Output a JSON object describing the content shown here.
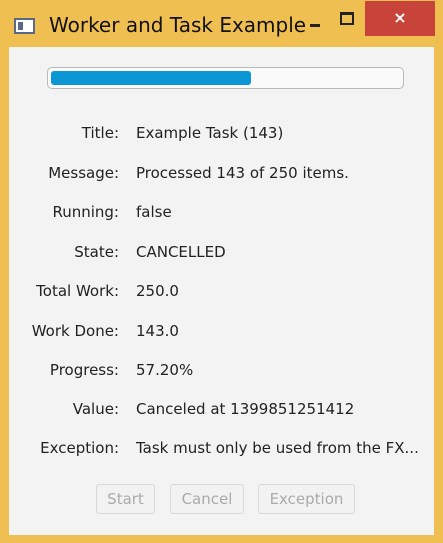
{
  "window": {
    "title": "Worker and Task Example",
    "icons": {
      "app": "window-icon",
      "minimize": "minimize-icon",
      "maximize": "maximize-icon",
      "close": "close-icon"
    },
    "close_glyph": "×",
    "accent_color": "#f0bf52",
    "close_color": "#c8433a"
  },
  "progress": {
    "fraction": 0.572,
    "fill_color": "#0b96d6"
  },
  "fields": [
    {
      "label": "Title:",
      "value": "Example Task (143)"
    },
    {
      "label": "Message:",
      "value": "Processed 143 of 250 items."
    },
    {
      "label": "Running:",
      "value": "false"
    },
    {
      "label": "State:",
      "value": "CANCELLED"
    },
    {
      "label": "Total Work:",
      "value": "250.0"
    },
    {
      "label": "Work Done:",
      "value": "143.0"
    },
    {
      "label": "Progress:",
      "value": "57.20%"
    },
    {
      "label": "Value:",
      "value": "Canceled at 1399851251412"
    },
    {
      "label": "Exception:",
      "value": "Task must only be used from the FX..."
    }
  ],
  "buttons": {
    "start": "Start",
    "cancel": "Cancel",
    "exception": "Exception"
  }
}
